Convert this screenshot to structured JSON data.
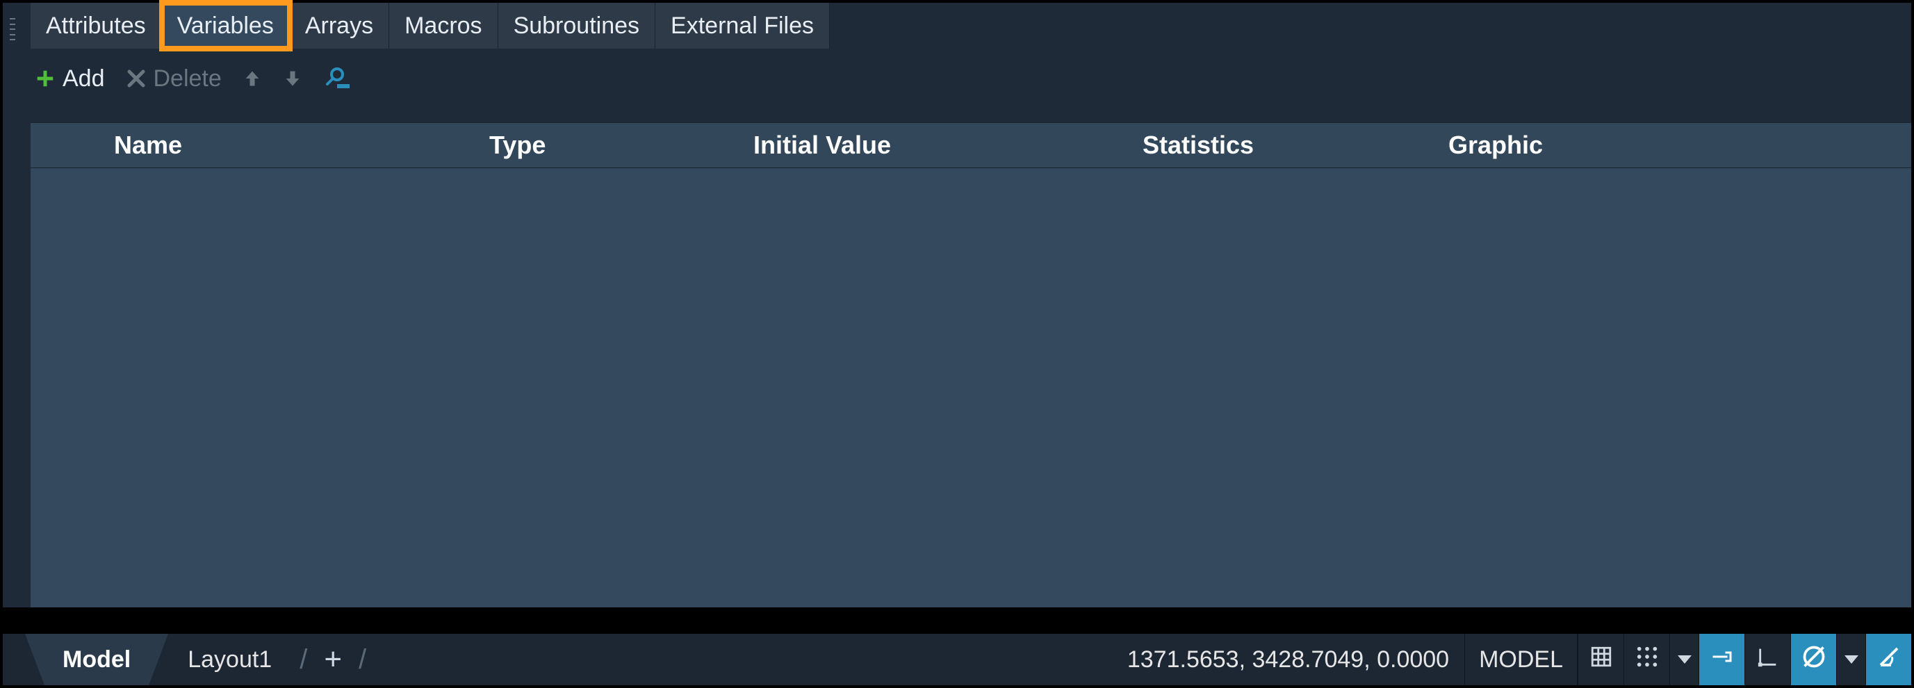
{
  "tabs": {
    "attributes": "Attributes",
    "variables": "Variables",
    "arrays": "Arrays",
    "macros": "Macros",
    "subroutines": "Subroutines",
    "external_files": "External Files"
  },
  "toolbar": {
    "add": "Add",
    "delete": "Delete"
  },
  "columns": {
    "name": "Name",
    "type": "Type",
    "initial_value": "Initial Value",
    "statistics": "Statistics",
    "graphic": "Graphic"
  },
  "statusbar": {
    "layout_model": "Model",
    "layout1": "Layout1",
    "coords": "1371.5653, 3428.7049, 0.0000",
    "model_indicator": "MODEL"
  },
  "icons": {
    "plus": "plus-icon",
    "x": "x-icon",
    "up": "arrow-up-icon",
    "down": "arrow-down-icon",
    "find": "find-icon",
    "grid": "grid-display-icon",
    "dots": "grid-snap-icon",
    "snap": "snap-icon",
    "ucs": "ucs-icon",
    "circle": "dynamic-input-icon",
    "angle": "polar-icon"
  }
}
